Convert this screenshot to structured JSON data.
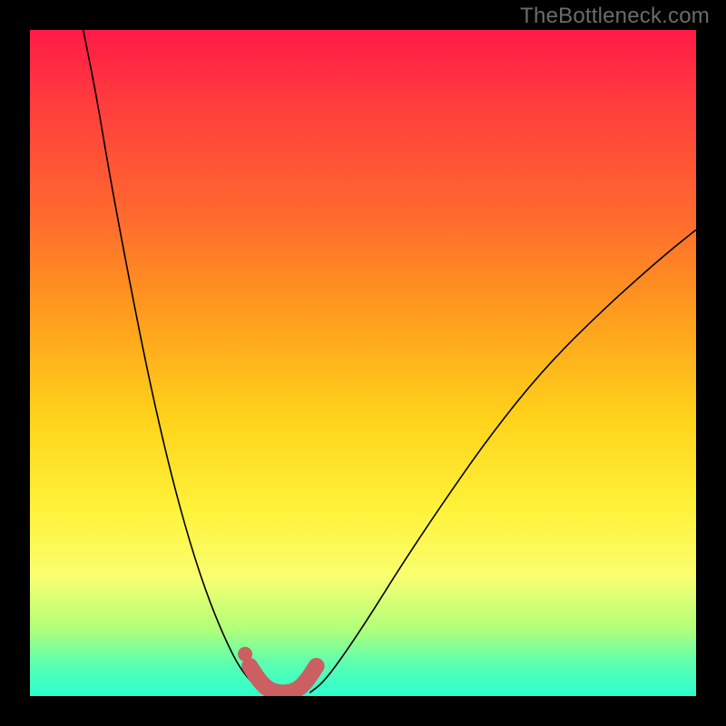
{
  "watermark": "TheBottleneck.com",
  "colors": {
    "background": "#000000",
    "gradient_top": "#ff1a47",
    "gradient_mid": "#fff23a",
    "gradient_bottom": "#2cffd0",
    "curve": "#000000",
    "trough_highlight": "#cb5f62"
  },
  "chart_data": {
    "type": "line",
    "title": "",
    "xlabel": "",
    "ylabel": "",
    "xlim": [
      0,
      100
    ],
    "ylim": [
      0,
      100
    ],
    "series": [
      {
        "name": "left-curve",
        "x": [
          8,
          10,
          12,
          15,
          18,
          21,
          24,
          27,
          30,
          32,
          34,
          35.6
        ],
        "y": [
          100,
          90,
          78,
          62,
          47,
          34,
          23,
          14,
          7,
          3.5,
          1.4,
          0.5
        ]
      },
      {
        "name": "right-curve",
        "x": [
          42,
          44,
          47,
          51,
          56,
          62,
          69,
          77,
          86,
          95,
          100
        ],
        "y": [
          0.5,
          2,
          6,
          12,
          20,
          29,
          39,
          49,
          58,
          66,
          70
        ]
      },
      {
        "name": "trough-band",
        "x": [
          33,
          34.5,
          36,
          38,
          40,
          41.5,
          43
        ],
        "y": [
          4.5,
          2.2,
          0.8,
          0.4,
          0.8,
          2.2,
          4.5
        ]
      }
    ],
    "annotations": [
      {
        "type": "point",
        "name": "trough-start-dot",
        "x": 32.3,
        "y": 6.3
      }
    ]
  }
}
